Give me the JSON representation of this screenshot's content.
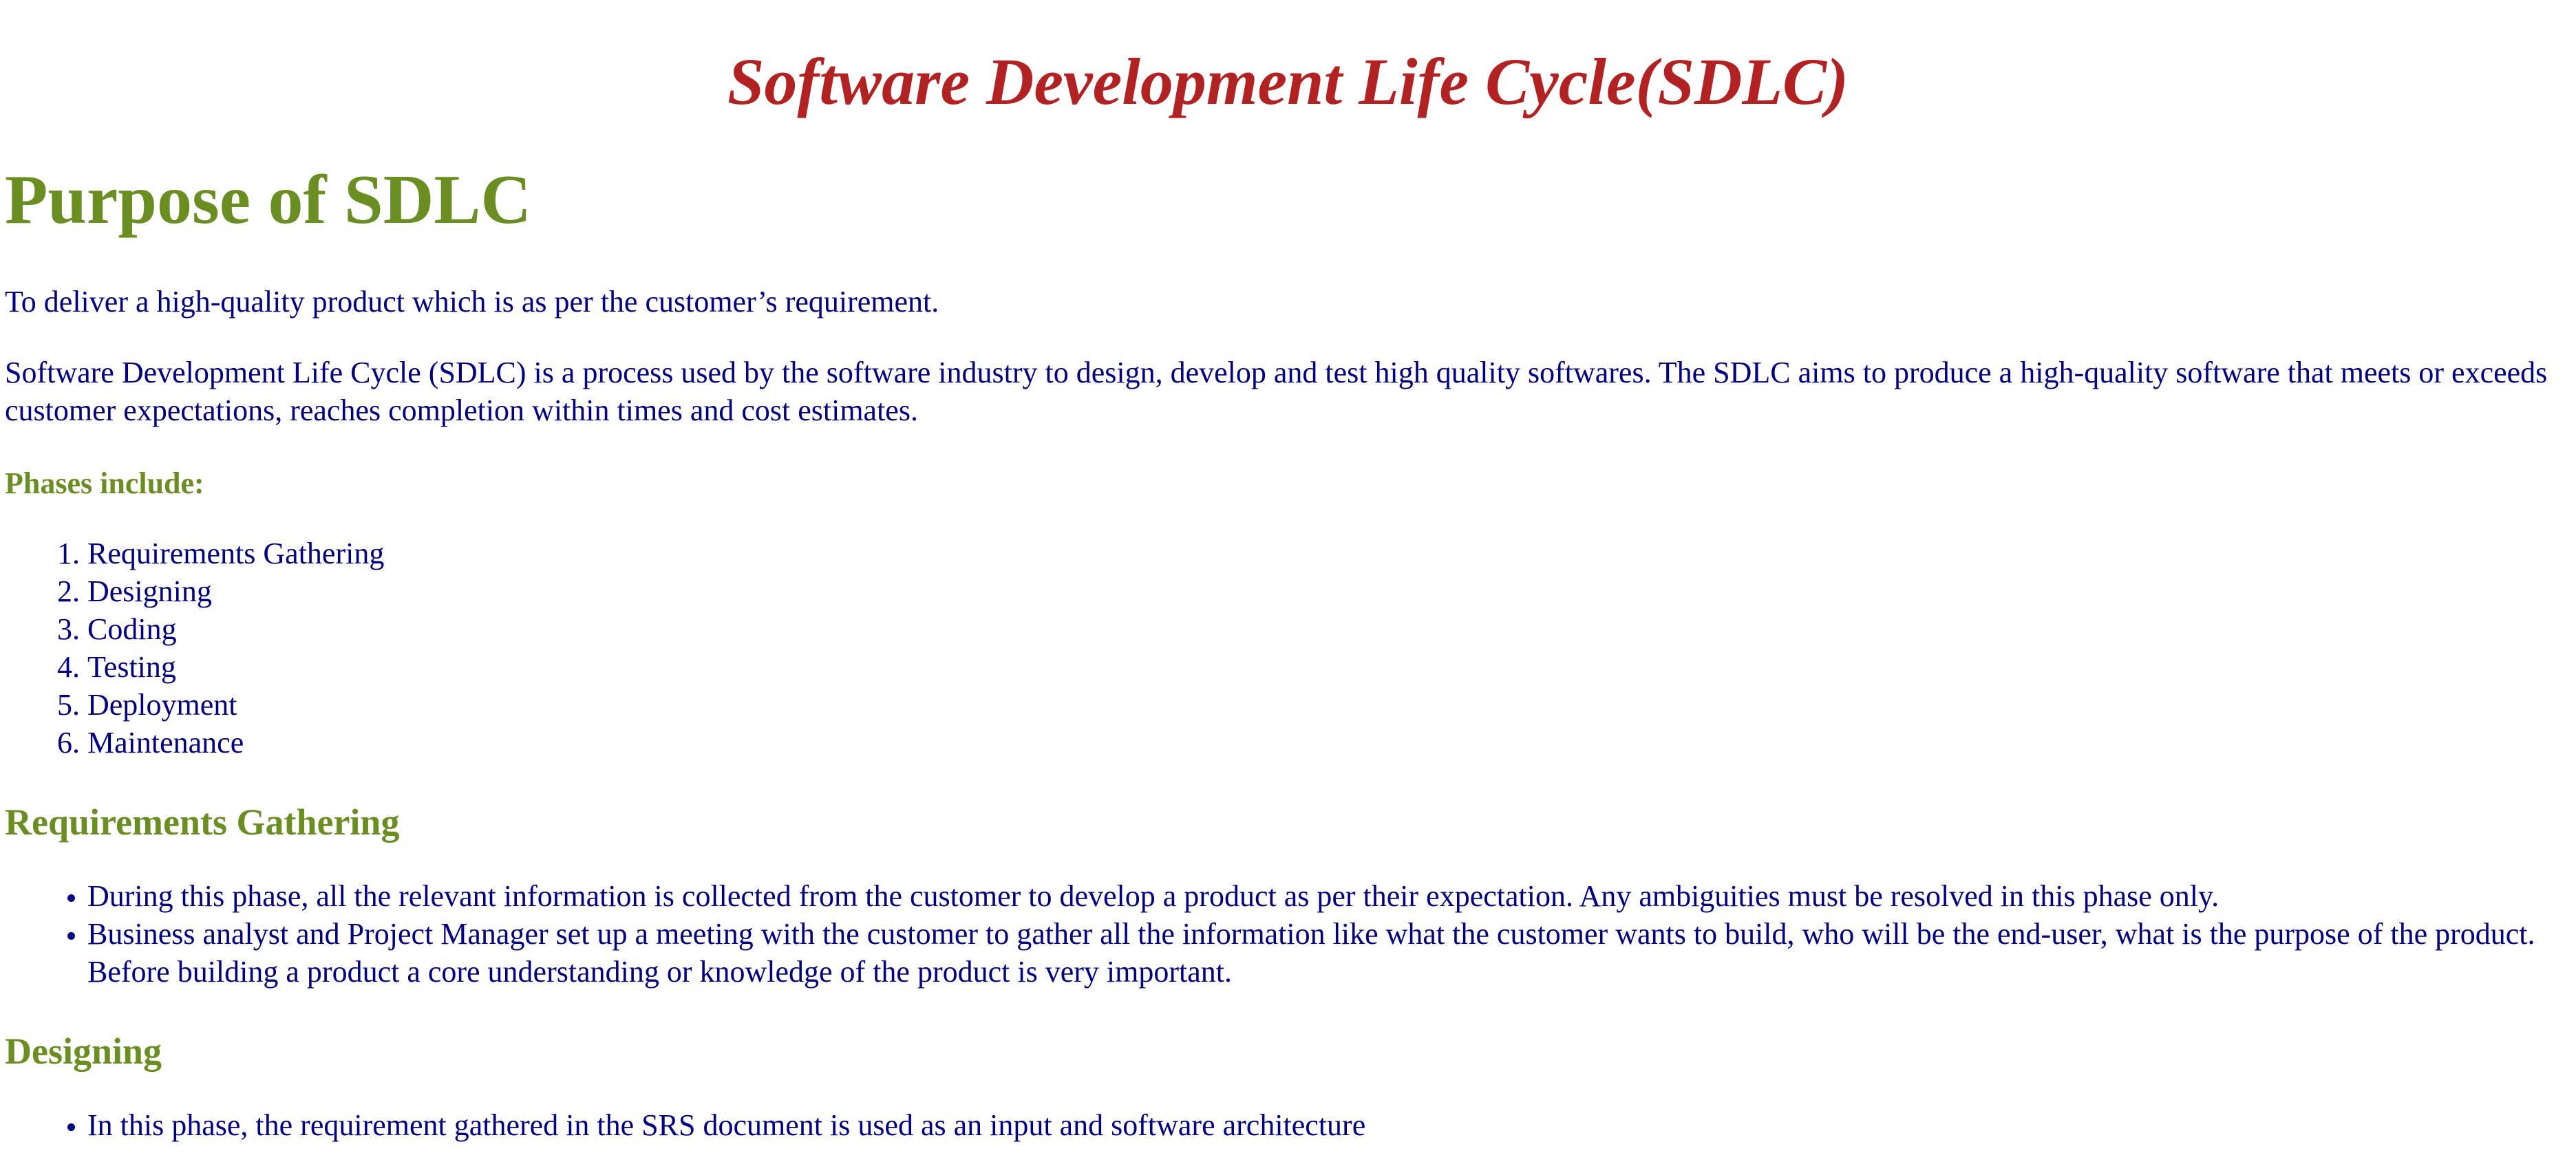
{
  "header": {
    "title": "Software Development Life Cycle(SDLC)"
  },
  "purpose": {
    "heading": "Purpose of SDLC",
    "intro": "To deliver a high-quality product which is as per the customer’s requirement.",
    "description": "Software Development Life Cycle (SDLC) is a process used by the software industry to design, develop and test high quality softwares. The SDLC aims to produce a high-quality software that meets or exceeds customer expectations, reaches completion within times and cost estimates.",
    "phases_label": "Phases include:",
    "phases": [
      "Requirements Gathering",
      "Designing",
      "Coding",
      "Testing",
      "Deployment",
      "Maintenance"
    ]
  },
  "requirements": {
    "heading": "Requirements Gathering",
    "bullets": [
      "During this phase, all the relevant information is collected from the customer to develop a product as per their expectation. Any ambiguities must be resolved in this phase only.",
      "Business analyst and Project Manager set up a meeting with the customer to gather all the information like what the customer wants to build, who will be the end-user, what is the purpose of the product. Before building a product a core understanding or knowledge of the product is very important."
    ]
  },
  "designing": {
    "heading": "Designing",
    "bullets": [
      "In this phase, the requirement gathered in the SRS document is used as an input and software architecture"
    ]
  },
  "colors": {
    "title": "#b22222",
    "heading": "#6b8e23",
    "body_text": "#000080",
    "background": "#ffffff"
  }
}
